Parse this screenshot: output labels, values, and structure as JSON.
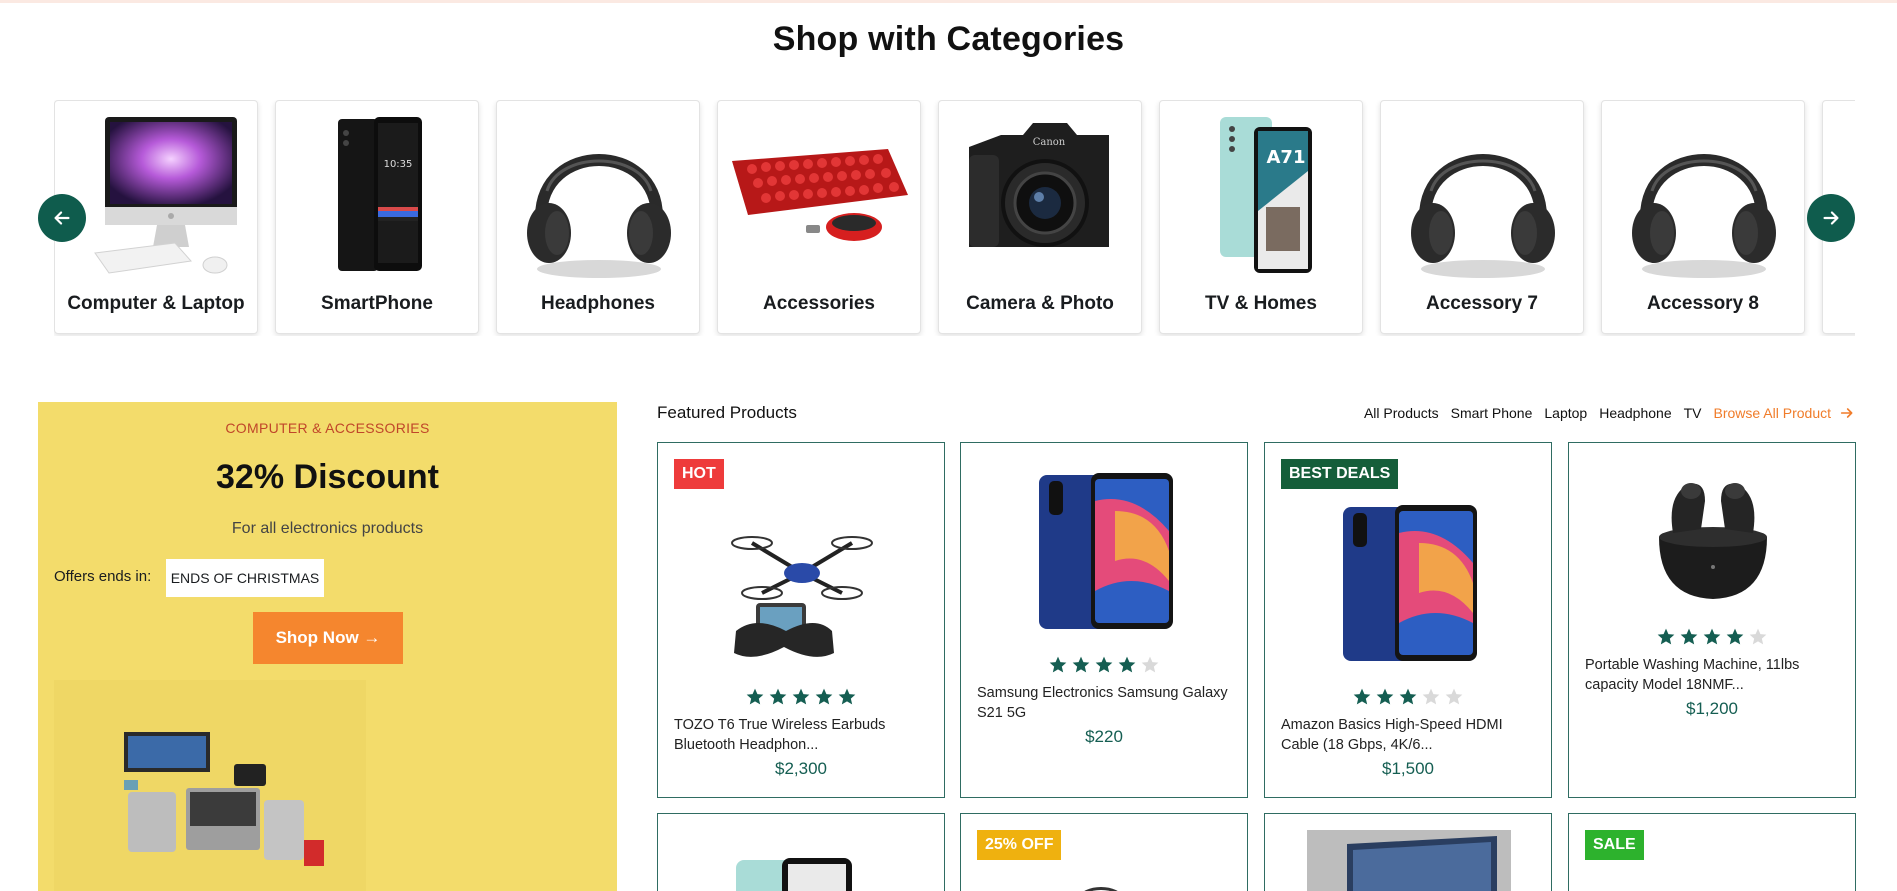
{
  "section_title": "Shop with Categories",
  "categories": [
    {
      "label": "Computer & Laptop",
      "icon": "desktop-computer-image"
    },
    {
      "label": "SmartPhone",
      "icon": "smartphone-image"
    },
    {
      "label": "Headphones",
      "icon": "headphones-image"
    },
    {
      "label": "Accessories",
      "icon": "keyboard-mouse-image"
    },
    {
      "label": "Camera & Photo",
      "icon": "camera-image"
    },
    {
      "label": "TV & Homes",
      "icon": "smartphone-image"
    },
    {
      "label": "Accessory 7",
      "icon": "headphones-image"
    },
    {
      "label": "Accessory 8",
      "icon": "headphones-image"
    }
  ],
  "carousel": {
    "prev_icon": "arrow-left-icon",
    "next_icon": "arrow-right-icon"
  },
  "promo": {
    "tag": "COMPUTER & ACCESSORIES",
    "title": "32% Discount",
    "subtitle": "For all electronics products",
    "offer_label": "Offers ends in:",
    "offer_value": "ENDS OF CHRISTMAS",
    "button_label": "Shop Now →"
  },
  "featured": {
    "title": "Featured Products",
    "filters": [
      "All Products",
      "Smart Phone",
      "Laptop",
      "Headphone",
      "TV"
    ],
    "browse_label": "Browse All Product",
    "products": [
      {
        "badge": "HOT",
        "badge_color": "#ee3b3b",
        "image": "drone-image",
        "rating": 5,
        "name": "TOZO T6 True Wireless Earbuds Bluetooth Headphon...",
        "price": "$2,300"
      },
      {
        "badge": "",
        "badge_color": "",
        "image": "smartphone-image",
        "rating": 4,
        "name": "Samsung Electronics Samsung Galaxy S21 5G",
        "price": "$220"
      },
      {
        "badge": "BEST DEALS",
        "badge_color": "#155e3a",
        "image": "smartphone-image",
        "rating": 3,
        "name": "Amazon Basics High-Speed HDMI Cable (18 Gbps, 4K/6...",
        "price": "$1,500"
      },
      {
        "badge": "",
        "badge_color": "",
        "image": "earbuds-image",
        "rating": 4,
        "name": "Portable Washing Machine, 11lbs capacity Model 18NMF...",
        "price": "$1,200"
      }
    ],
    "second_row": [
      {
        "badge": "",
        "badge_color": ""
      },
      {
        "badge": "25% OFF",
        "badge_color": "#efb10f"
      },
      {
        "badge": "",
        "badge_color": ""
      },
      {
        "badge": "SALE",
        "badge_color": "#2db22d"
      }
    ]
  }
}
